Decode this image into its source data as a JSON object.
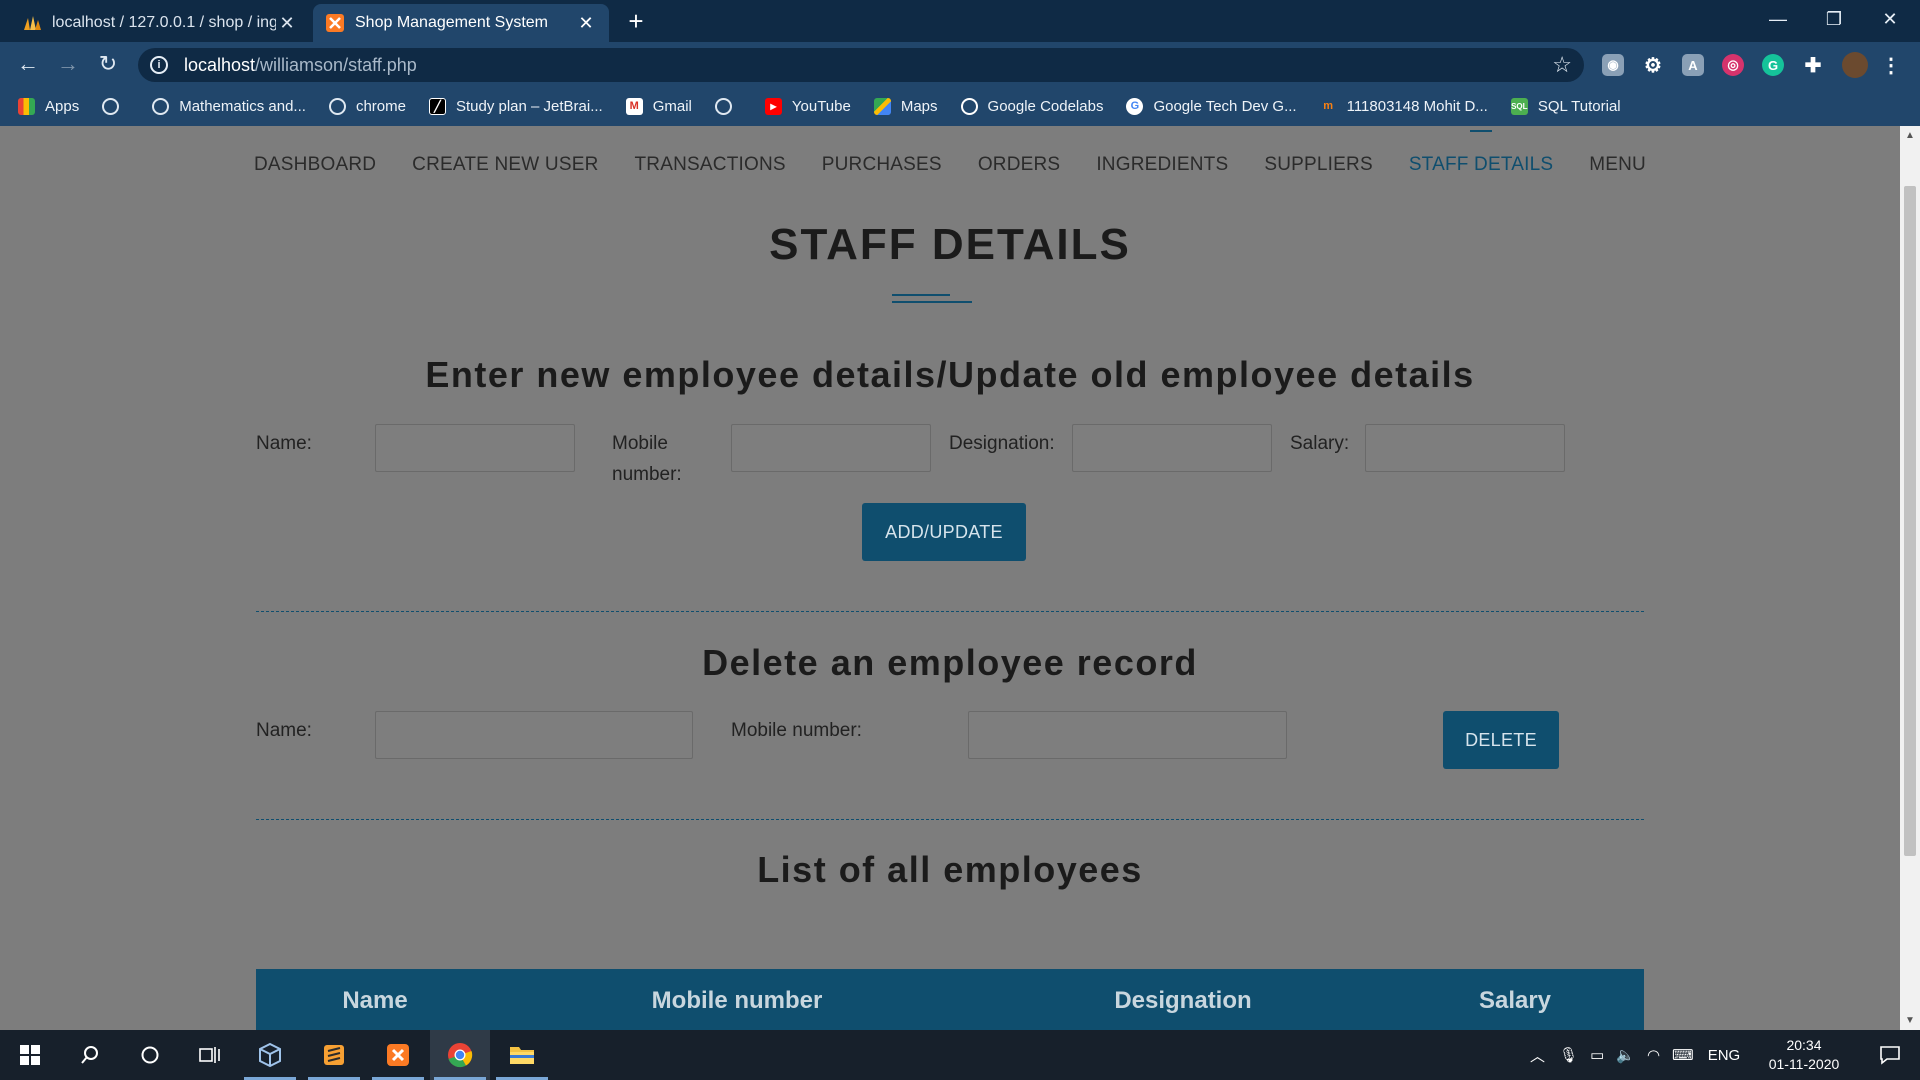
{
  "browser": {
    "tabs": [
      {
        "title": "localhost / 127.0.0.1 / shop / ingr",
        "active": false
      },
      {
        "title": "Shop Management System",
        "active": true
      }
    ],
    "url_host": "localhost",
    "url_path": "/williamson/staff.php",
    "bookmarks": [
      {
        "label": "Apps",
        "icon": "apps-grid-icon"
      },
      {
        "label": "",
        "icon": "globe-icon"
      },
      {
        "label": "Mathematics and...",
        "icon": "globe-icon"
      },
      {
        "label": "chrome",
        "icon": "globe-icon"
      },
      {
        "label": "Study plan – JetBrai...",
        "icon": "jetbrains-icon"
      },
      {
        "label": "Gmail",
        "icon": "gmail-icon"
      },
      {
        "label": "",
        "icon": "globe-icon"
      },
      {
        "label": "YouTube",
        "icon": "youtube-icon"
      },
      {
        "label": "Maps",
        "icon": "maps-icon"
      },
      {
        "label": "Google Codelabs",
        "icon": "codelabs-icon"
      },
      {
        "label": "Google Tech Dev G...",
        "icon": "google-icon"
      },
      {
        "label": "111803148 Mohit D...",
        "icon": "moodle-icon"
      },
      {
        "label": "SQL Tutorial",
        "icon": "sql-icon"
      }
    ]
  },
  "nav": {
    "items": [
      "DASHBOARD",
      "CREATE NEW USER",
      "TRANSACTIONS",
      "PURCHASES",
      "ORDERS",
      "INGREDIENTS",
      "SUPPLIERS",
      "STAFF DETAILS",
      "MENU"
    ],
    "active": "STAFF DETAILS"
  },
  "page": {
    "title": "STAFF DETAILS",
    "add_section": {
      "heading": "Enter new employee details/Update old employee details",
      "name_label": "Name:",
      "mobile_label_line1": "Mobile",
      "mobile_label_line2": "number:",
      "designation_label": "Designation:",
      "salary_label": "Salary:",
      "name_value": "",
      "mobile_value": "",
      "designation_value": "",
      "salary_value": "",
      "button": "ADD/UPDATE"
    },
    "delete_section": {
      "heading": "Delete an employee record",
      "name_label": "Name:",
      "mobile_label": "Mobile number:",
      "name_value": "",
      "mobile_value": "",
      "button": "DELETE"
    },
    "list_section": {
      "heading": "List of all employees",
      "columns": [
        "Name",
        "Mobile number",
        "Designation",
        "Salary"
      ]
    }
  },
  "taskbar": {
    "language": "ENG",
    "time": "20:34",
    "date": "01-11-2020"
  },
  "colors": {
    "accent": "#0f4e6e",
    "page_background": "#7d7d7d",
    "browser_frame": "#21466b"
  }
}
